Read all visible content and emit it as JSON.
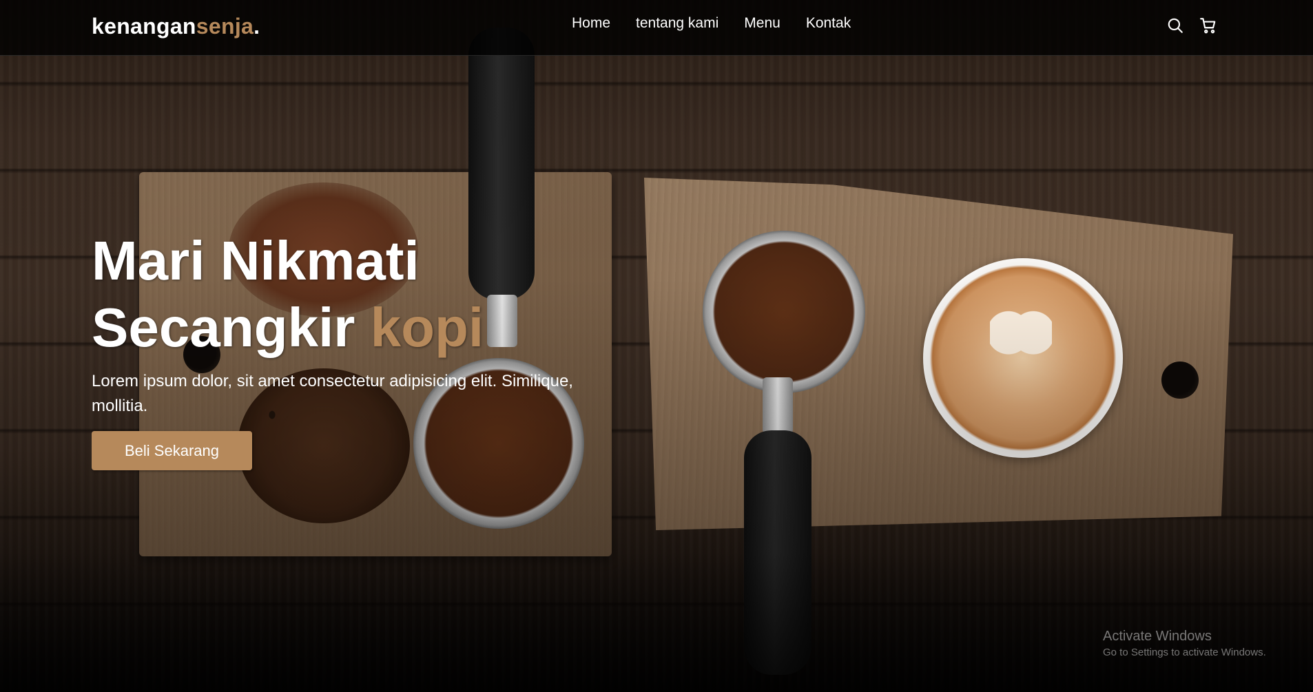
{
  "brand": {
    "name_part1": "kenangan",
    "name_part2": "senja",
    "name_dot": ".",
    "accent_color": "#b6895b"
  },
  "nav": {
    "links": [
      {
        "label": "Home"
      },
      {
        "label": "tentang kami"
      },
      {
        "label": "Menu"
      },
      {
        "label": "Kontak"
      }
    ],
    "icons": [
      "search-icon",
      "shopping-cart-icon"
    ]
  },
  "hero": {
    "title_line1": "Mari Nikmati",
    "title_line2_part1": "Secangkir ",
    "title_line2_accent": "kopi",
    "description": "Lorem ipsum dolor, sit amet consectetur adipisicing elit. Similique, mollitia.",
    "cta_label": "Beli Sekarang"
  },
  "watermark": {
    "title": "Activate Windows",
    "subtitle": "Go to Settings to activate Windows."
  }
}
